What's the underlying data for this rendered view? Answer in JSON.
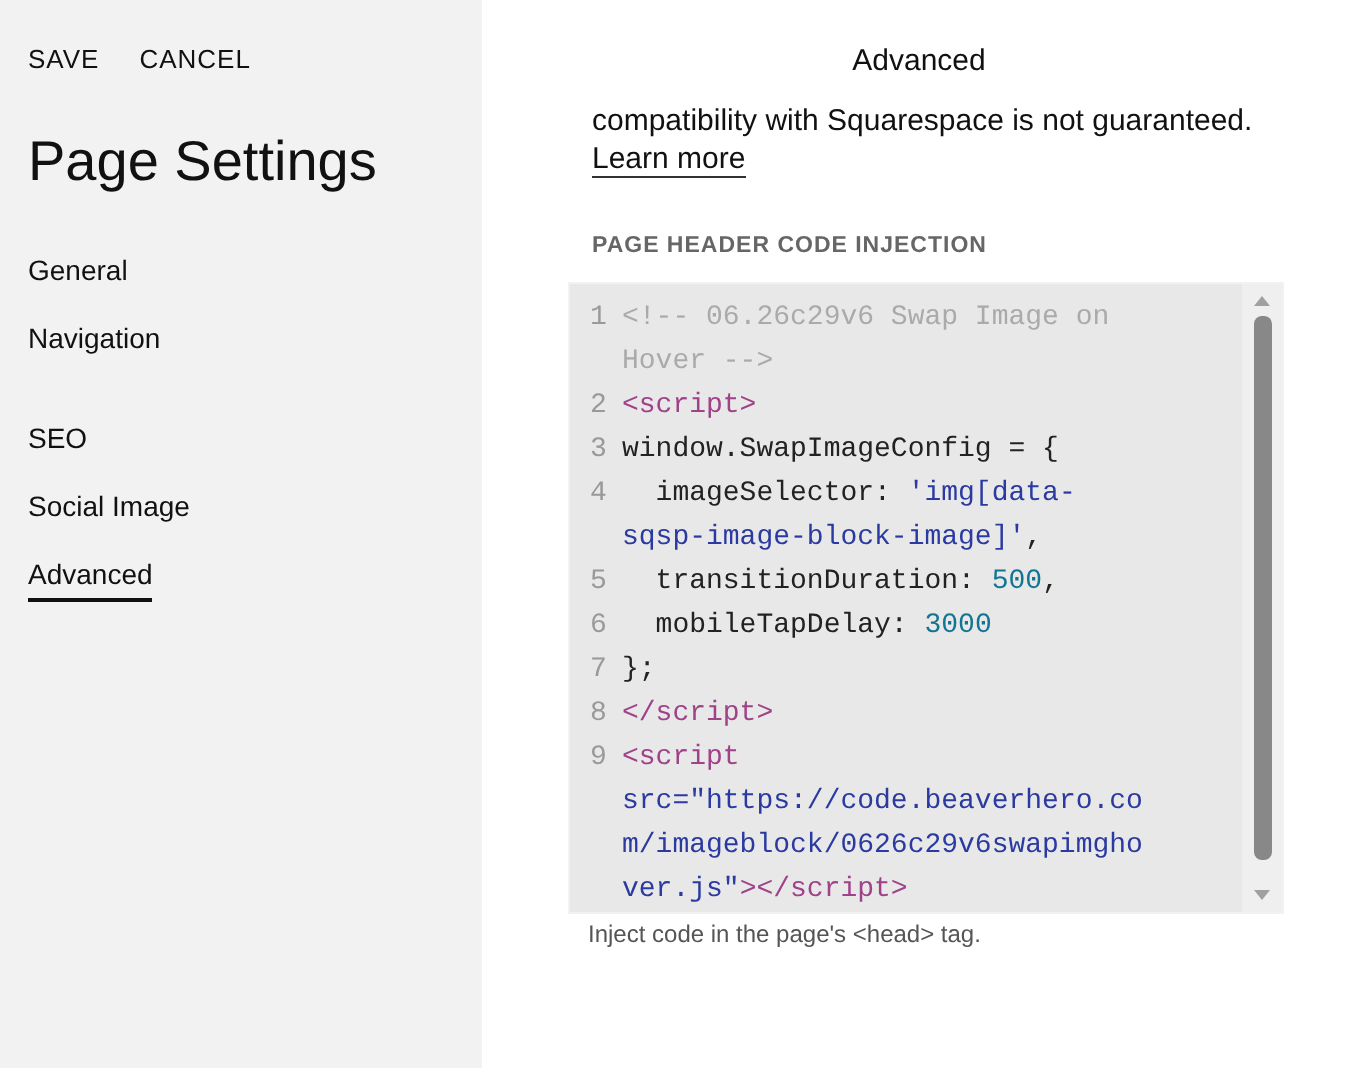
{
  "toolbar": {
    "buttons": [
      "SAVE",
      "CANCEL"
    ]
  },
  "sidebar": {
    "title": "Page Settings",
    "groups": [
      {
        "items": [
          {
            "label": "General",
            "selected": false
          },
          {
            "label": "Navigation",
            "selected": false
          }
        ]
      },
      {
        "items": [
          {
            "label": "SEO",
            "selected": false
          },
          {
            "label": "Social Image",
            "selected": false
          },
          {
            "label": "Advanced",
            "selected": true
          }
        ]
      }
    ]
  },
  "panel": {
    "title": "Advanced",
    "intro": "compatibility with Squarespace is not guaranteed.",
    "link": "Learn more",
    "section_label": "PAGE HEADER CODE INJECTION",
    "code_lines": [
      {
        "number": "1",
        "rows": [
          [
            {
              "kind": "comment",
              "text": "<!-- 06.26c29v6 Swap Image on"
            }
          ],
          [
            {
              "kind": "comment",
              "text": "Hover -->"
            }
          ]
        ]
      },
      {
        "number": "2",
        "rows": [
          [
            {
              "kind": "tag",
              "text": "<script>"
            }
          ]
        ]
      },
      {
        "number": "3",
        "rows": [
          [
            {
              "kind": "plain",
              "text": "window.SwapImageConfig = {"
            }
          ]
        ]
      },
      {
        "number": "4",
        "rows": [
          [
            {
              "kind": "plain",
              "text": "  imageSelector: "
            },
            {
              "kind": "string",
              "text": "'img[data-"
            }
          ],
          [
            {
              "kind": "string",
              "text": "sqsp-image-block-image]'"
            },
            {
              "kind": "plain",
              "text": ","
            }
          ]
        ]
      },
      {
        "number": "5",
        "rows": [
          [
            {
              "kind": "plain",
              "text": "  transitionDuration: "
            },
            {
              "kind": "number",
              "text": "500"
            },
            {
              "kind": "plain",
              "text": ","
            }
          ]
        ]
      },
      {
        "number": "6",
        "rows": [
          [
            {
              "kind": "plain",
              "text": "  mobileTapDelay: "
            },
            {
              "kind": "number",
              "text": "3000"
            }
          ]
        ]
      },
      {
        "number": "7",
        "rows": [
          [
            {
              "kind": "plain",
              "text": "};"
            }
          ]
        ]
      },
      {
        "number": "8",
        "rows": [
          [
            {
              "kind": "tag",
              "text": "</script>"
            }
          ]
        ]
      },
      {
        "number": "9",
        "rows": [
          [
            {
              "kind": "tag",
              "text": "<script"
            }
          ],
          [
            {
              "kind": "attr",
              "text": "src="
            },
            {
              "kind": "attrvalue",
              "text": "\"https://code.beaverhero.co"
            }
          ],
          [
            {
              "kind": "attrvalue",
              "text": "m/imageblock/0626c29v6swapimgho"
            }
          ],
          [
            {
              "kind": "attrvalue",
              "text": "ver.js\""
            },
            {
              "kind": "tag",
              "text": "></script>"
            }
          ]
        ]
      }
    ],
    "help": "Inject code in the page's <head> tag."
  }
}
